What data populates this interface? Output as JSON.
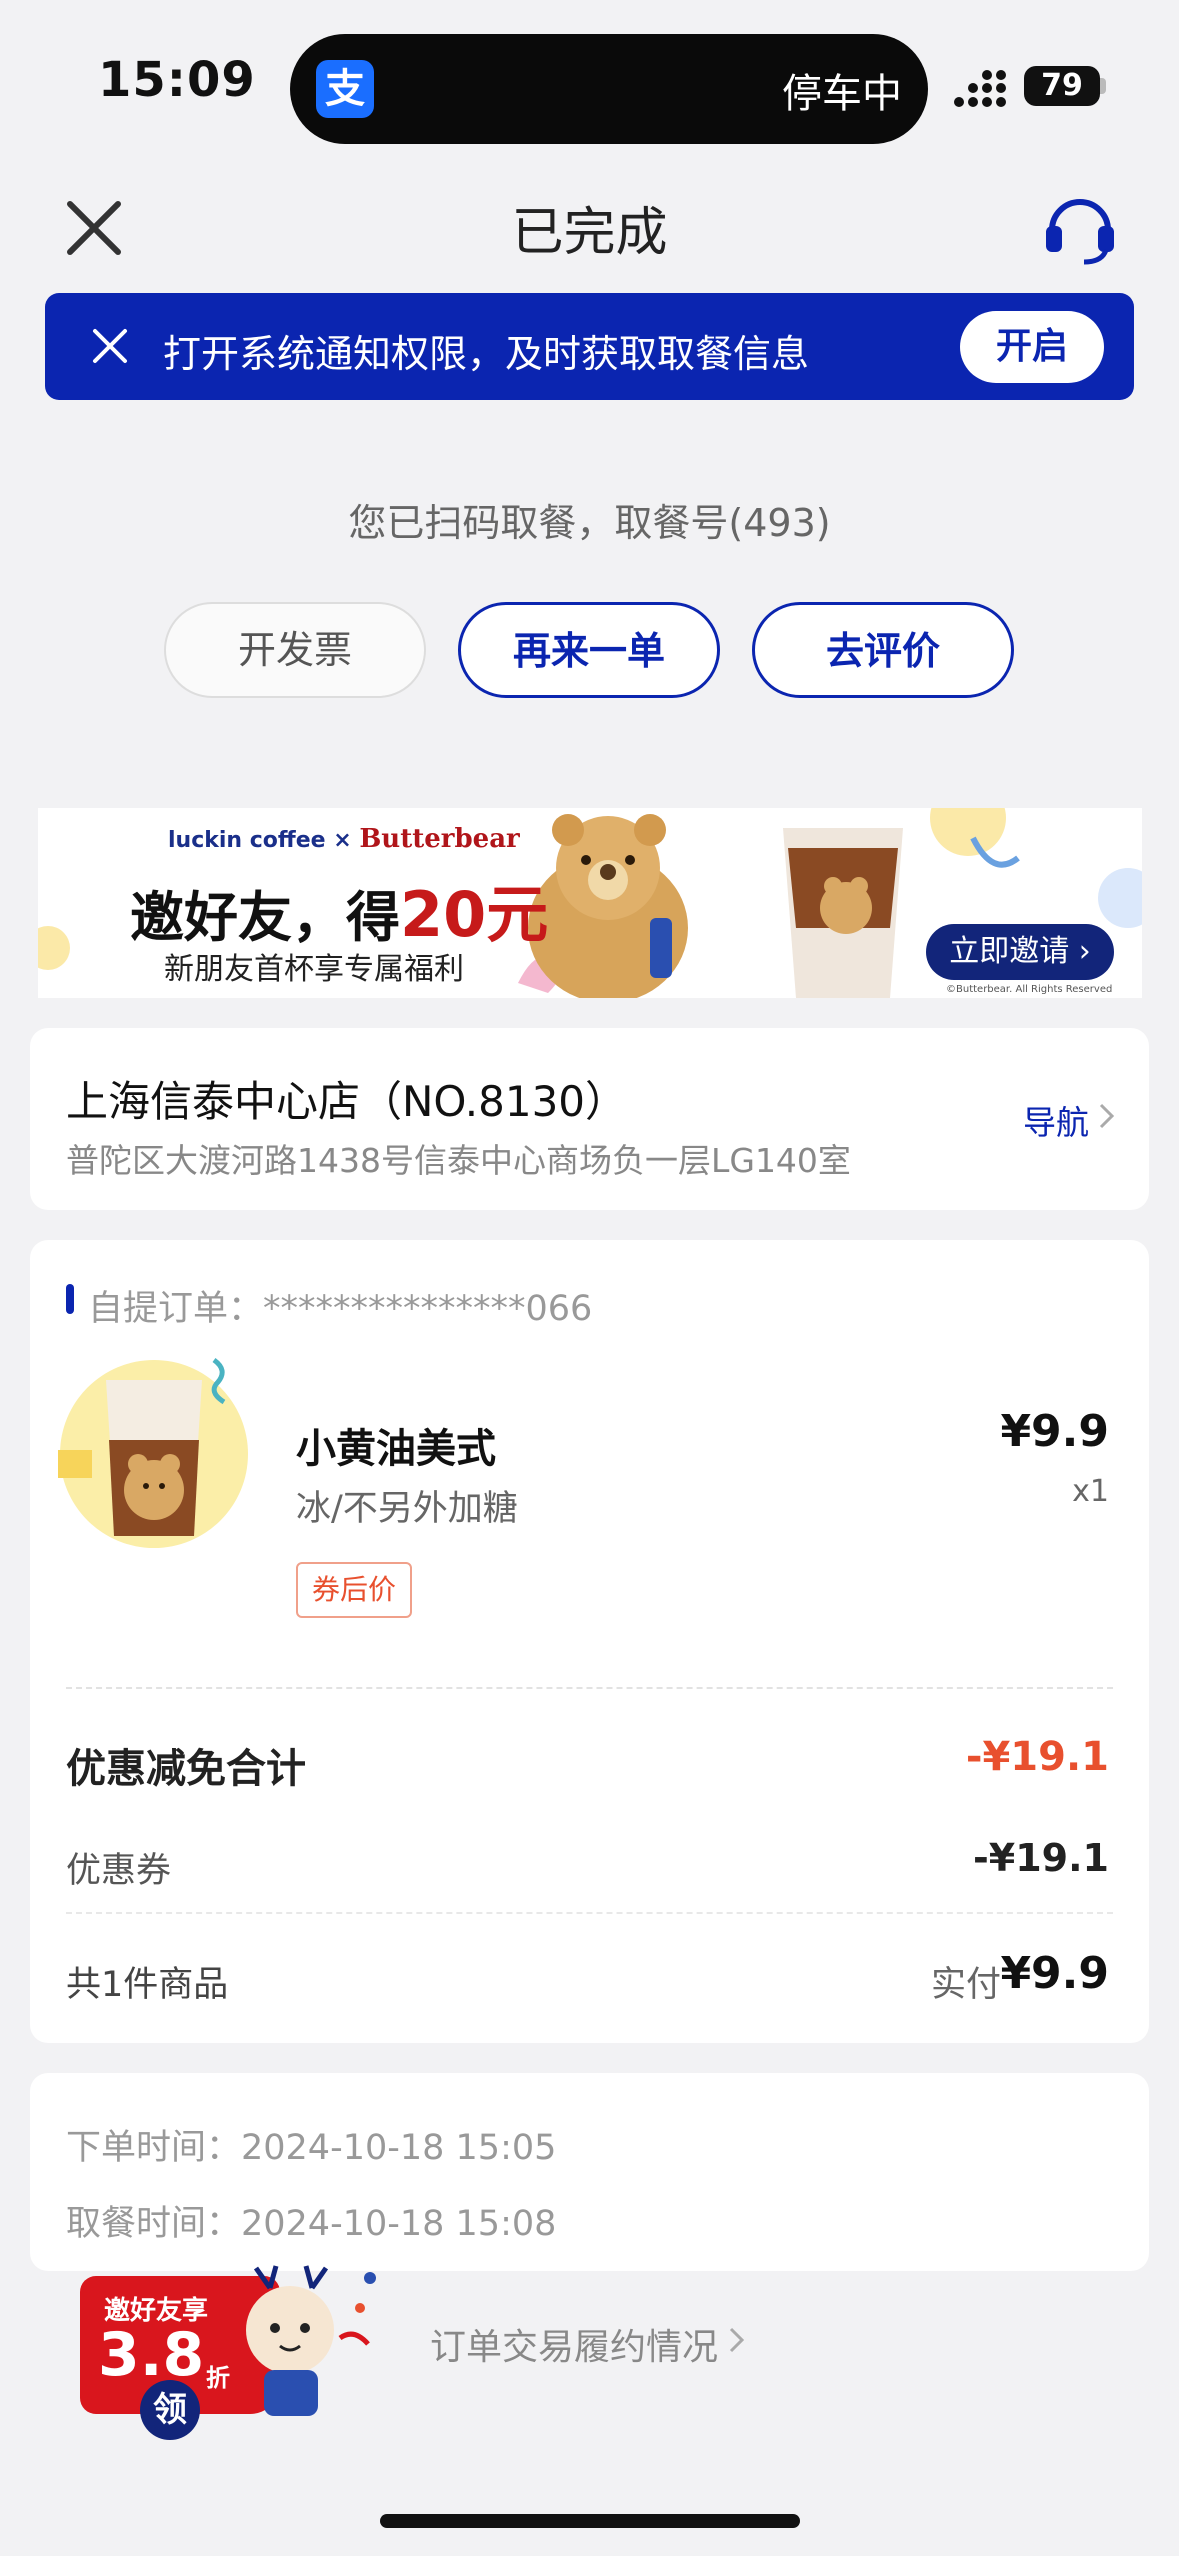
{
  "status_bar": {
    "time": "15:09",
    "island_app_icon": "支",
    "island_text": "停车中",
    "battery": "79"
  },
  "header": {
    "title": "已完成"
  },
  "notification_banner": {
    "text": "打开系统通知权限，及时获取取餐信息",
    "button": "开启",
    "background": "#0b25b0"
  },
  "pickup": {
    "text": "您已扫码取餐，取餐号(493)"
  },
  "actions": {
    "invoice": "开发票",
    "reorder": "再来一单",
    "review": "去评价"
  },
  "promo": {
    "brand": "luckin coffee",
    "partner": "Butterbear",
    "headline_prefix": "邀好友，得",
    "headline_amount": "20元",
    "subtitle": "新朋友首杯享专属福利",
    "cta": "立即邀请",
    "copyright": "©Butterbear. All Rights Reserved"
  },
  "store": {
    "name": "上海信泰中心店（NO.8130）",
    "address": "普陀区大渡河路1438号信泰中心商场负一层LG140室",
    "nav_label": "导航"
  },
  "order": {
    "id_label": "自提订单：***************066",
    "item": {
      "name": "小黄油美式",
      "options": "冰/不另外加糖",
      "tag": "券后价",
      "price": "¥9.9",
      "qty": "x1"
    },
    "discount_total_label": "优惠减免合计",
    "discount_total_value": "-¥19.1",
    "coupon_label": "优惠券",
    "coupon_value": "-¥19.1",
    "count_label": "共1件商品",
    "paid_label": "实付",
    "paid_value": "¥9.9"
  },
  "times": {
    "order_time": "下单时间：2024-10-18 15:05",
    "pickup_time": "取餐时间：2024-10-18 15:08"
  },
  "float_invite": {
    "top": "邀好友享",
    "big": "3.8",
    "small": "折",
    "claim": "领"
  },
  "fulfillment_link": "订单交易履约情况"
}
